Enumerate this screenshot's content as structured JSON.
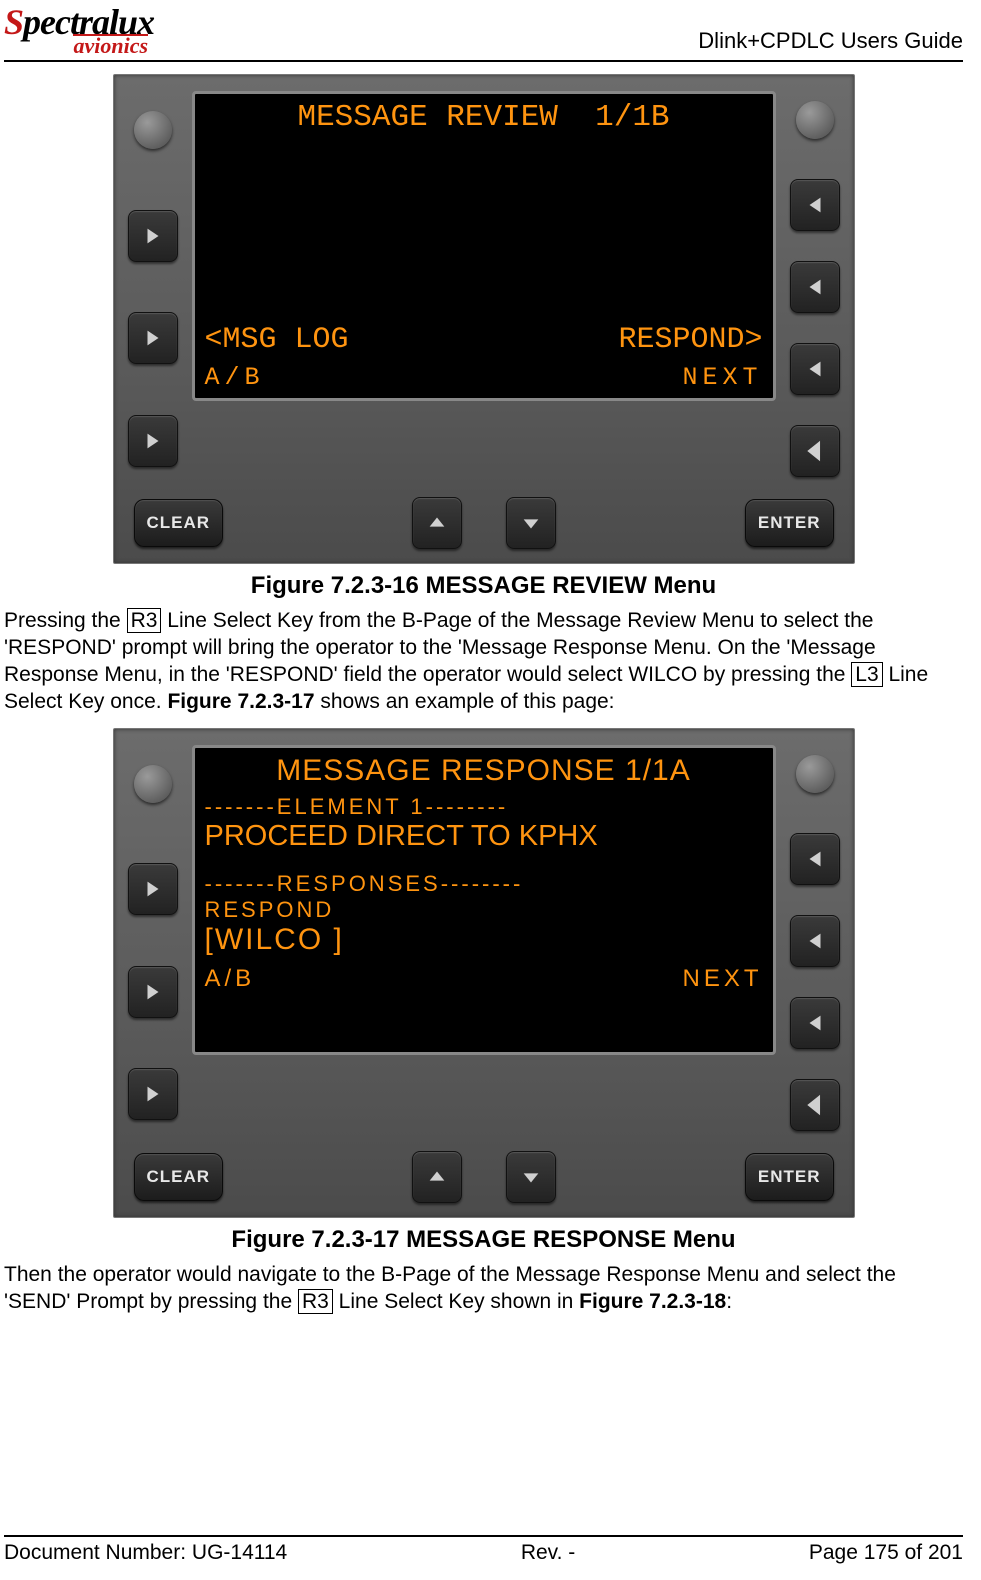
{
  "header": {
    "logo_main": "Spectralux",
    "logo_sub": "avionics",
    "doc_title": "Dlink+CPDLC Users Guide"
  },
  "figure1": {
    "caption": "Figure 7.2.3-16 MESSAGE REVIEW Menu",
    "screen": {
      "title": "MESSAGE REVIEW  1/1B",
      "msg_log": "<MSG LOG",
      "respond": "RESPOND>",
      "ab": "A/B",
      "next": "NEXT"
    },
    "keys": {
      "clear": "CLEAR",
      "enter": "ENTER"
    }
  },
  "para1": {
    "t1": "Pressing the ",
    "k1": "R3",
    "t2": " Line Select Key from the B-Page of the Message Review Menu to select the 'RESPOND' prompt will bring the operator to the 'Message Response Menu.  On the 'Message Response Menu, in the 'RESPOND' field the operator would select WILCO by pressing the ",
    "k2": "L3",
    "t3": " Line Select Key once.  ",
    "b1": "Figure 7.2.3-17",
    "t4": "  shows an example of this page:"
  },
  "figure2": {
    "caption": "Figure 7.2.3-17 MESSAGE RESPONSE Menu",
    "screen": {
      "title": "MESSAGE RESPONSE 1/1A",
      "element_hdr": "-------ELEMENT 1--------",
      "proceed": "PROCEED DIRECT TO KPHX",
      "responses_hdr": "-------RESPONSES--------",
      "respond_lbl": "RESPOND",
      "wilco": "[WILCO  ]",
      "ab": "A/B",
      "next": "NEXT"
    },
    "keys": {
      "clear": "CLEAR",
      "enter": "ENTER"
    }
  },
  "para2": {
    "t1": "Then the operator would navigate to the B-Page of the Message Response Menu and select the 'SEND' Prompt by pressing the ",
    "k1": "R3",
    "t2": " Line Select Key shown in ",
    "b1": "Figure 7.2.3-18",
    "t3": ":"
  },
  "footer": {
    "docnum": "Document Number:  UG-14114",
    "rev": "Rev. -",
    "page": "Page 175 of 201"
  }
}
